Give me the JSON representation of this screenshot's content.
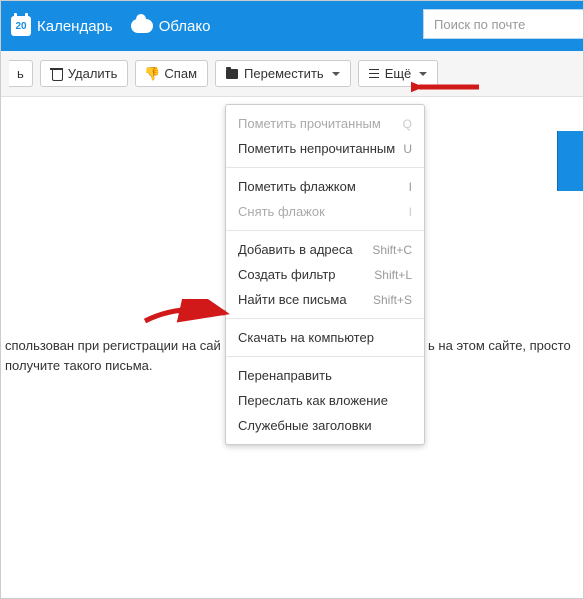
{
  "colors": {
    "brand": "#168de2",
    "arrow": "#d11919"
  },
  "topbar": {
    "calendar": {
      "label": "Календарь",
      "day": "20"
    },
    "cloud": {
      "label": "Облако"
    },
    "search": {
      "placeholder": "Поиск по почте"
    }
  },
  "toolbar": {
    "reply_fragment": "ь",
    "delete": "Удалить",
    "spam": "Спам",
    "move": "Переместить",
    "more": "Ещё"
  },
  "menu": {
    "s1": [
      {
        "label": "Пометить прочитанным",
        "shortcut": "Q",
        "disabled": true
      },
      {
        "label": "Пометить непрочитанным",
        "shortcut": "U",
        "disabled": false
      }
    ],
    "s2": [
      {
        "label": "Пометить флажком",
        "shortcut": "I",
        "disabled": false
      },
      {
        "label": "Снять флажок",
        "shortcut": "I",
        "disabled": true
      }
    ],
    "s3": [
      {
        "label": "Добавить в адреса",
        "shortcut": "Shift+C"
      },
      {
        "label": "Создать фильтр",
        "shortcut": "Shift+L"
      },
      {
        "label": "Найти все письма",
        "shortcut": "Shift+S"
      }
    ],
    "s4": [
      {
        "label": "Скачать на компьютер"
      }
    ],
    "s5": [
      {
        "label": "Перенаправить"
      },
      {
        "label": "Переслать как вложение"
      },
      {
        "label": "Служебные заголовки"
      }
    ]
  },
  "body": {
    "line1_left": "спользован при регистрации на сай",
    "line1_right": "ь на этом сайте, просто",
    "line2": "получите такого письма."
  }
}
